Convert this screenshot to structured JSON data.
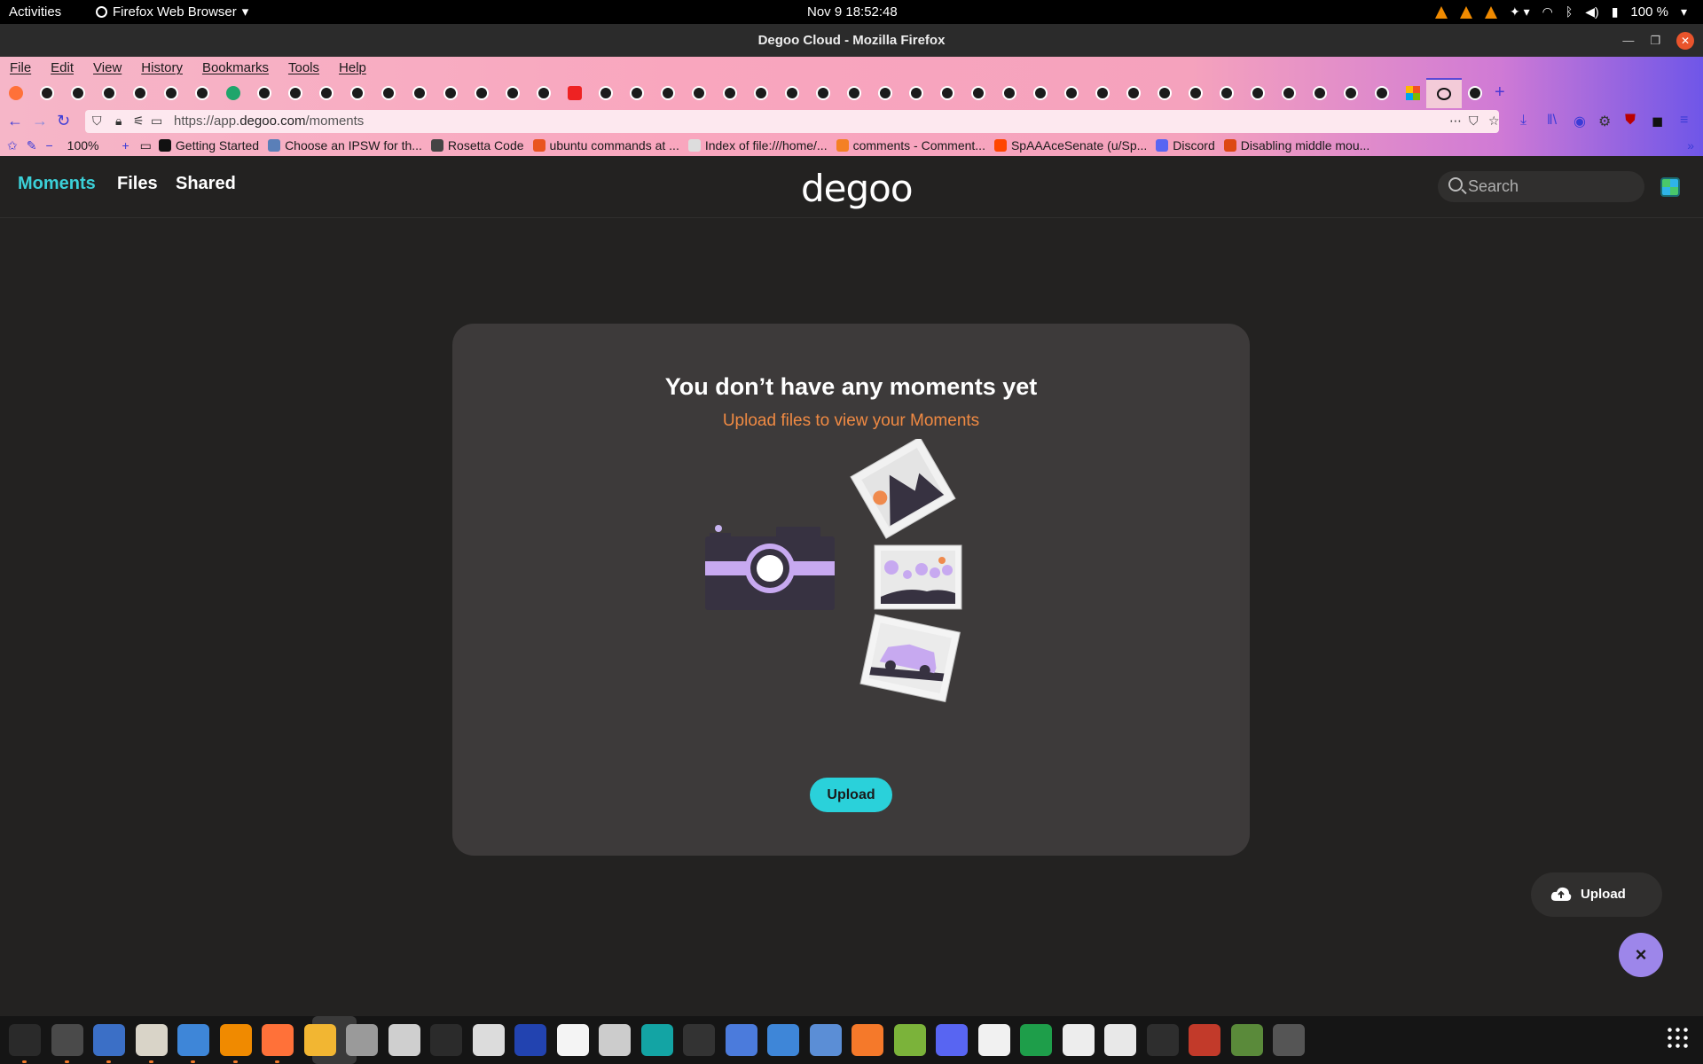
{
  "topbar": {
    "activities": "Activities",
    "app_name": "Firefox Web Browser",
    "clock": "Nov 9  18:52:48",
    "battery": "100 %"
  },
  "window": {
    "title": "Degoo Cloud - Mozilla Firefox"
  },
  "menubar": [
    "File",
    "Edit",
    "View",
    "History",
    "Bookmarks",
    "Tools",
    "Help"
  ],
  "navbar": {
    "url_prefix": "https://app.",
    "url_domain": "degoo.com",
    "url_path": "/moments",
    "zoom": "100%"
  },
  "bookmarks": [
    {
      "label": "Getting Started",
      "icon": "medium-icon",
      "color": "#111111"
    },
    {
      "label": "Choose an IPSW for th...",
      "icon": "ipsw-icon",
      "color": "#5a7fb8"
    },
    {
      "label": "Rosetta Code",
      "icon": "rosetta-icon",
      "color": "#444444"
    },
    {
      "label": "ubuntu commands at ...",
      "icon": "ubuntu-icon",
      "color": "#e95420"
    },
    {
      "label": "Index of file:///home/...",
      "icon": "file-icon",
      "color": "#dddddd"
    },
    {
      "label": "comments - Comment...",
      "icon": "stackoverflow-icon",
      "color": "#f48024"
    },
    {
      "label": "SpAAAceSenate (u/Sp...",
      "icon": "reddit-icon",
      "color": "#ff4500"
    },
    {
      "label": "Discord",
      "icon": "discord-icon",
      "color": "#5865f2"
    },
    {
      "label": "Disabling middle mou...",
      "icon": "askubuntu-icon",
      "color": "#dd4814"
    }
  ],
  "app": {
    "nav": {
      "moments": "Moments",
      "files": "Files",
      "shared": "Shared"
    },
    "logo": "degoo",
    "search_placeholder": "Search",
    "accent": "#3bd0d8",
    "empty_state": {
      "title": "You don’t have any moments yet",
      "subtitle": "Upload files to view your Moments",
      "upload_label": "Upload"
    },
    "fab": {
      "upload_label": "Upload",
      "close_glyph": "×"
    }
  }
}
